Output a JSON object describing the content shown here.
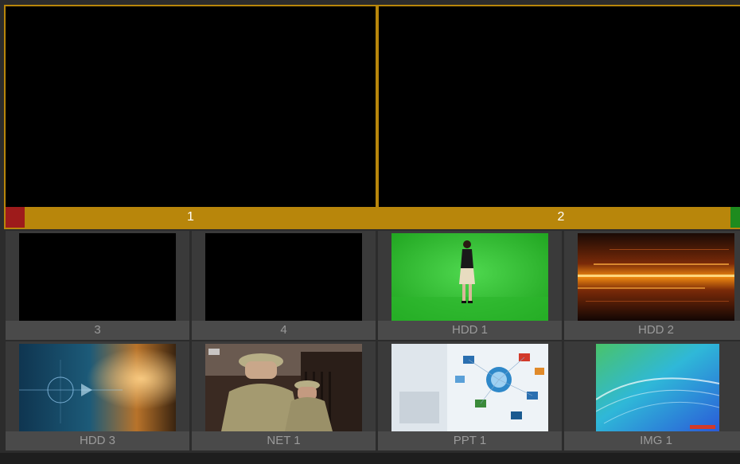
{
  "monitors": [
    {
      "label": "1",
      "tally_color": "#9e1b1b"
    },
    {
      "label": "2",
      "tally_color": "#1e8b1e"
    }
  ],
  "sources": [
    {
      "label": "3",
      "content": "black"
    },
    {
      "label": "4",
      "content": "black"
    },
    {
      "label": "HDD 1",
      "content": "green-screen-presenter"
    },
    {
      "label": "HDD 2",
      "content": "light-streaks"
    },
    {
      "label": "HDD 3",
      "content": "tech-blue-orange"
    },
    {
      "label": "NET 1",
      "content": "soldiers-scene"
    },
    {
      "label": "PPT 1",
      "content": "presentation-collage"
    },
    {
      "label": "IMG 1",
      "content": "abstract-waves"
    }
  ],
  "colors": {
    "accent": "#b8860b",
    "tally_red": "#9e1b1b",
    "tally_green": "#1e8b1e",
    "background": "#2c2c2c"
  }
}
